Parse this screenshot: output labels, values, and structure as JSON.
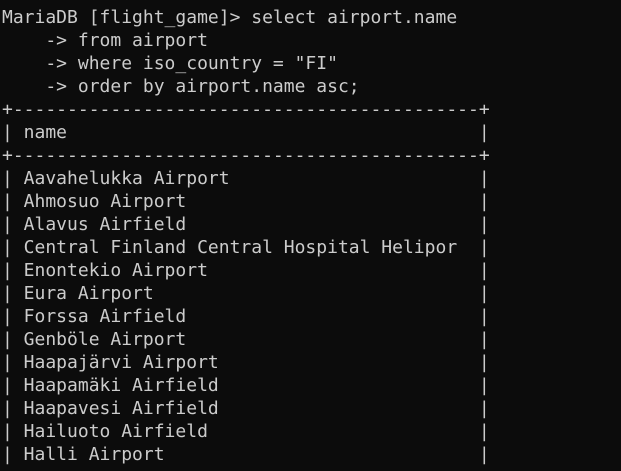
{
  "terminal": {
    "query_lines": [
      "MariaDB [flight_game]> select airport.name",
      "    -> from airport",
      "    -> where iso_country = \"FI\"",
      "    -> order by airport.name asc;"
    ],
    "table": {
      "border_line": "+-------------------------------------------+",
      "header_line": "| name                                      |",
      "rows": [
        "| Aavahelukka Airport                       |",
        "| Ahmosuo Airport                           |",
        "| Alavus Airfield                           |",
        "| Central Finland Central Hospital Helipor  |",
        "| Enontekio Airport                         |",
        "| Eura Airport                              |",
        "| Forssa Airfield                           |",
        "| Genböle Airport                           |",
        "| Haapajärvi Airport                        |",
        "| Haapamäki Airfield                        |",
        "| Haapavesi Airfield                        |",
        "| Hailuoto Airfield                         |",
        "| Halli Airport                             |"
      ]
    }
  }
}
